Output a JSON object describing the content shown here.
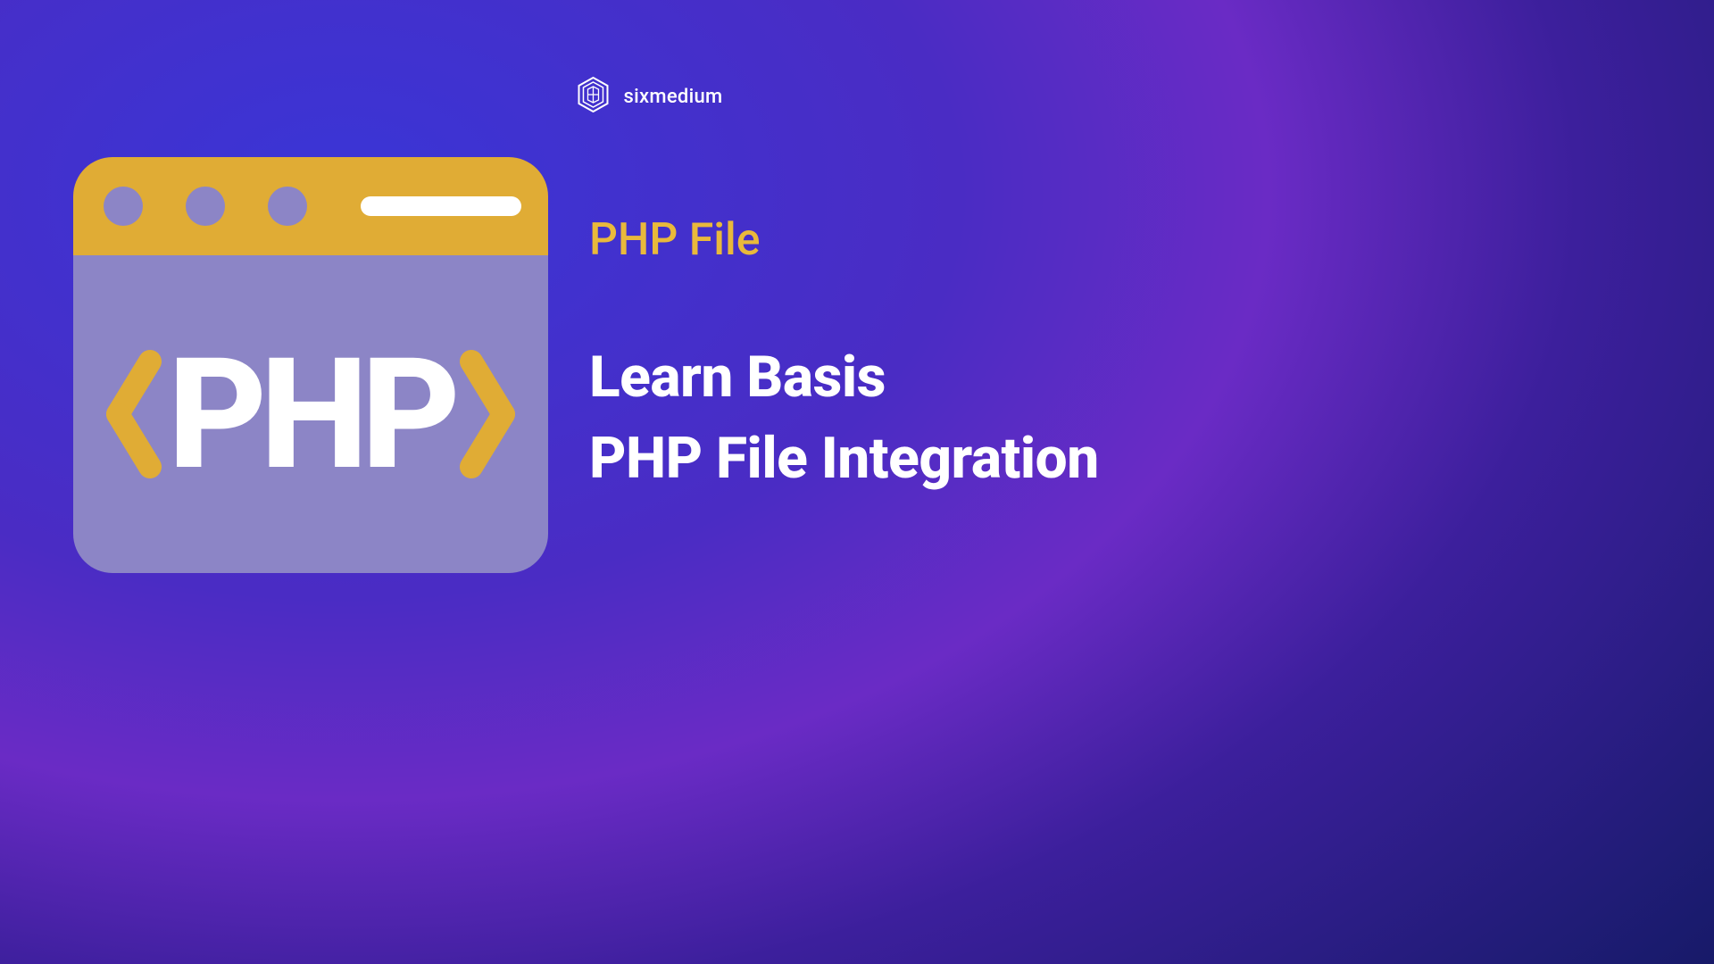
{
  "brand": {
    "name": "sixmedium"
  },
  "content": {
    "category": "PHP File",
    "headline_line1": "Learn Basis",
    "headline_line2": "PHP File Integration"
  },
  "illustration": {
    "php_text": "PHP"
  },
  "colors": {
    "accent_gold": "#e9b93b",
    "window_gold": "#e0ac35",
    "window_body": "#8c85c6",
    "text_white": "#ffffff"
  }
}
